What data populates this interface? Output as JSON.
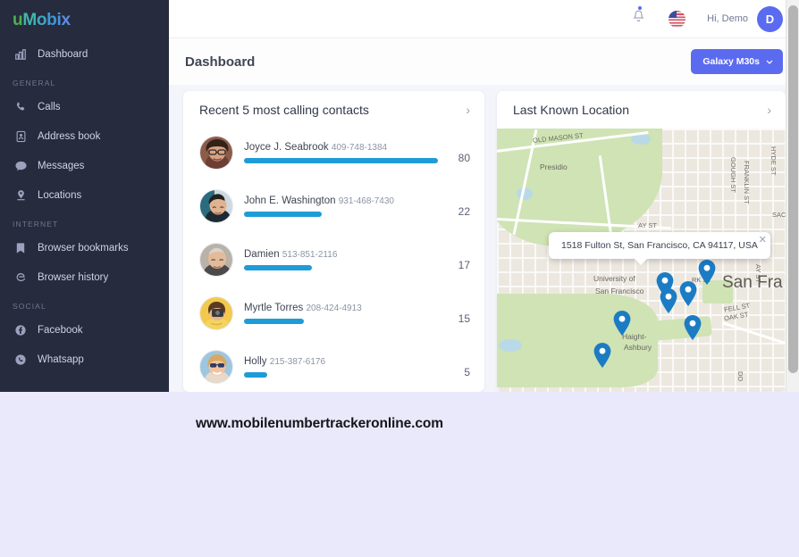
{
  "app": {
    "logo": "uMobix",
    "logo_chars": [
      "u",
      "M",
      "o",
      "b",
      "i",
      "x"
    ]
  },
  "sidebar": {
    "items": [
      {
        "label": "Dashboard",
        "icon": "chart-bar-icon",
        "name": "dashboard"
      }
    ],
    "sections": [
      {
        "label": "GENERAL",
        "items": [
          {
            "label": "Calls",
            "icon": "phone-icon",
            "name": "calls"
          },
          {
            "label": "Address book",
            "icon": "contact-card-icon",
            "name": "address-book"
          },
          {
            "label": "Messages",
            "icon": "chat-bubble-icon",
            "name": "messages"
          },
          {
            "label": "Locations",
            "icon": "map-pin-icon",
            "name": "locations"
          }
        ]
      },
      {
        "label": "INTERNET",
        "items": [
          {
            "label": "Browser bookmarks",
            "icon": "bookmark-icon",
            "name": "browser-bookmarks"
          },
          {
            "label": "Browser history",
            "icon": "edge-browser-icon",
            "name": "browser-history"
          }
        ]
      },
      {
        "label": "SOCIAL",
        "items": [
          {
            "label": "Facebook",
            "icon": "facebook-icon",
            "name": "facebook"
          },
          {
            "label": "Whatsapp",
            "icon": "whatsapp-icon",
            "name": "whatsapp"
          }
        ]
      }
    ]
  },
  "topbar": {
    "bell_icon": "bell-icon",
    "has_notification": true,
    "flag": "us-flag-icon",
    "greeting": "Hi, Demo",
    "avatar_initial": "D"
  },
  "page": {
    "title": "Dashboard",
    "device_button": "Galaxy M30s",
    "device_chevron": "⌄"
  },
  "contacts_card": {
    "title": "Recent 5 most calling contacts",
    "arrow": "›",
    "max_value": 80,
    "rows": [
      {
        "name": "Joyce J. Seabrook",
        "phone": "409-748-1384",
        "count": 80,
        "bar_pct": 100,
        "avatar_name": "avatar-joyce"
      },
      {
        "name": "John E. Washington",
        "phone": "931-468-7430",
        "count": 22,
        "bar_pct": 40,
        "avatar_name": "avatar-john"
      },
      {
        "name": "Damien",
        "phone": "513-851-2116",
        "count": 17,
        "bar_pct": 35,
        "avatar_name": "avatar-damien"
      },
      {
        "name": "Myrtle Torres",
        "phone": "208-424-4913",
        "count": 15,
        "bar_pct": 31,
        "avatar_name": "avatar-myrtle"
      },
      {
        "name": "Holly",
        "phone": "215-387-6176",
        "count": 5,
        "bar_pct": 12,
        "avatar_name": "avatar-holly"
      }
    ]
  },
  "location_card": {
    "title": "Last Known Location",
    "arrow": "›",
    "tooltip_address": "1518 Fulton St, San Francisco, CA 94117, USA",
    "tooltip_close": "✕",
    "map_labels": [
      "OLD MASON ST",
      "Presidio",
      "GOUGH ST",
      "FRANKLIN ST",
      "HYDE ST",
      "SAC",
      "AY ST",
      "University of",
      "San Francisco",
      "San Fra",
      "RK ST",
      "FELL ST",
      "OAK ST",
      "Haight-",
      "Ashbury",
      "AY ST",
      "DO"
    ],
    "pin_count": 7,
    "pin_color": "#1b7cc4"
  },
  "watermark": {
    "text": "www.mobilenumbertrackeronline.com"
  },
  "colors": {
    "sidebar_bg": "#262b3d",
    "accent_purple": "#5b6bf0",
    "bar_blue": "#1e9cd7",
    "page_bg": "#f4f5fb",
    "watermark_bg": "#eae9fb"
  }
}
